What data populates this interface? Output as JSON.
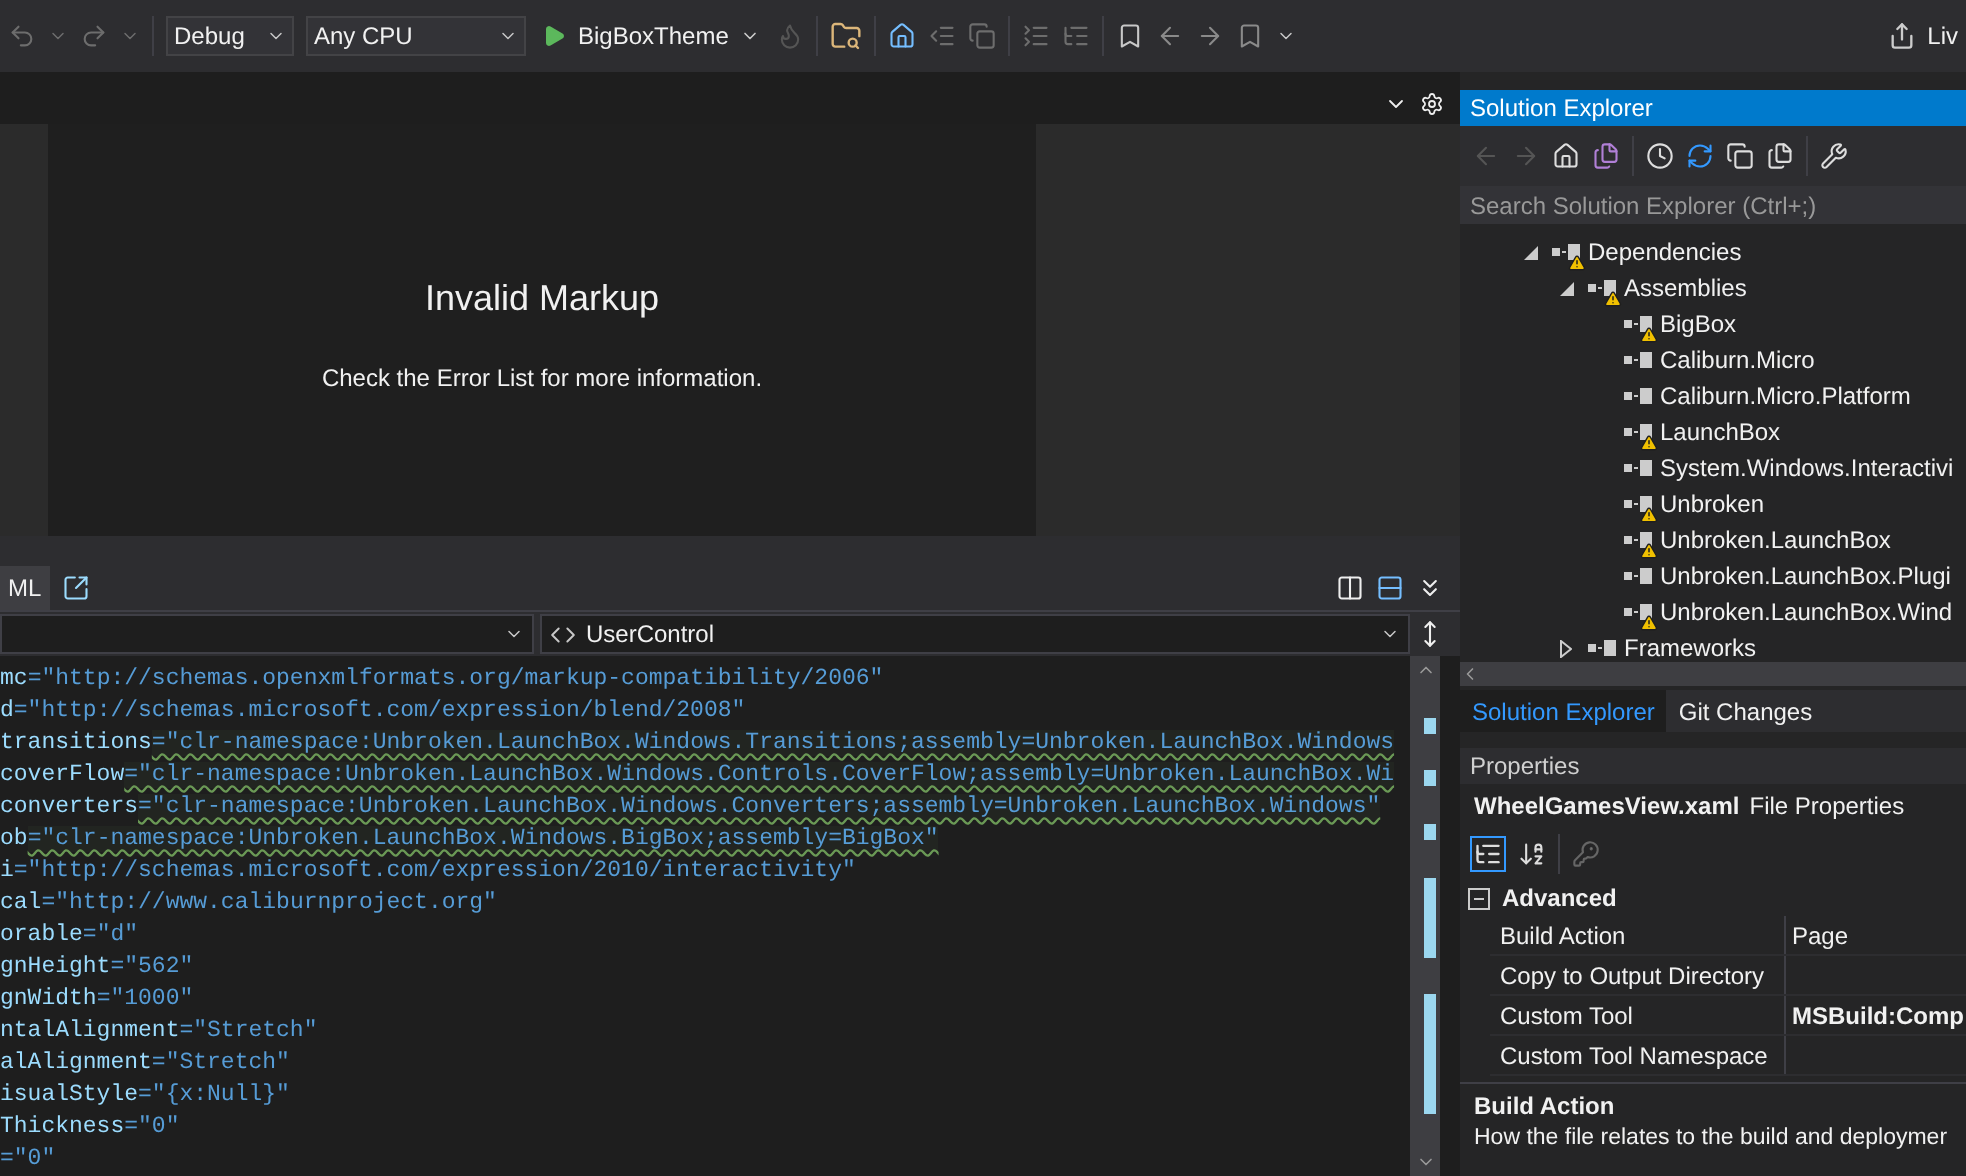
{
  "toolbar": {
    "configuration": "Debug",
    "platform": "Any CPU",
    "start_target": "BigBoxTheme",
    "live_share": "Liv"
  },
  "designer": {
    "title": "Invalid Markup",
    "message": "Check the Error List for more information."
  },
  "editor_tabs": [
    {
      "label": "ML",
      "selected": true
    }
  ],
  "navigation": {
    "scope": "UserControl"
  },
  "code_lines": [
    {
      "attr": "mc",
      "value": "=\"http://schemas.openxmlformats.org/markup-compatibility/2006\"",
      "squiggle": false
    },
    {
      "attr": "d",
      "value": "=\"http://schemas.microsoft.com/expression/blend/2008\"",
      "squiggle": false
    },
    {
      "attr": "transitions",
      "value": "=\"clr-namespace:Unbroken.LaunchBox.Windows.Transitions;assembly=Unbroken.LaunchBox.Windows",
      "squiggle": true
    },
    {
      "attr": "coverFlow",
      "value": "=\"clr-namespace:Unbroken.LaunchBox.Windows.Controls.CoverFlow;assembly=Unbroken.LaunchBox.Wi",
      "squiggle": true
    },
    {
      "attr": "converters",
      "value": "=\"clr-namespace:Unbroken.LaunchBox.Windows.Converters;assembly=Unbroken.LaunchBox.Windows\"",
      "squiggle": true
    },
    {
      "attr": "ob",
      "value": "=\"clr-namespace:Unbroken.LaunchBox.Windows.BigBox;assembly=BigBox\"",
      "squiggle": true
    },
    {
      "attr": "i",
      "value": "=\"http://schemas.microsoft.com/expression/2010/interactivity\"",
      "squiggle": false
    },
    {
      "attr": "cal",
      "value": "=\"http://www.caliburnproject.org\"",
      "squiggle": false
    },
    {
      "attr": "orable",
      "value": "=\"d\"",
      "squiggle": false
    },
    {
      "attr": "gnHeight",
      "value": "=\"562\"",
      "squiggle": false
    },
    {
      "attr": "gnWidth",
      "value": "=\"1000\"",
      "squiggle": false
    },
    {
      "attr": "ntalAlignment",
      "value": "=\"Stretch\"",
      "squiggle": false
    },
    {
      "attr": "alAlignment",
      "value": "=\"Stretch\"",
      "squiggle": false
    },
    {
      "attr": "isualStyle",
      "value": "=\"{x:Null}\"",
      "squiggle": false
    },
    {
      "attr": "Thickness",
      "value": "=\"0\"",
      "squiggle": false
    },
    {
      "value": "=\"0\"",
      "squiggle": false
    }
  ],
  "solution_explorer": {
    "title": "Solution Explorer",
    "search_placeholder": "Search Solution Explorer (Ctrl+;)",
    "tree": [
      {
        "label": "Dependencies",
        "expanded": true,
        "warning": true,
        "children": [
          {
            "label": "Assemblies",
            "expanded": true,
            "warning": true,
            "children": [
              {
                "label": "BigBox",
                "warning": true
              },
              {
                "label": "Caliburn.Micro",
                "warning": false
              },
              {
                "label": "Caliburn.Micro.Platform",
                "warning": false
              },
              {
                "label": "LaunchBox",
                "warning": true
              },
              {
                "label": "System.Windows.Interactivi",
                "warning": false
              },
              {
                "label": "Unbroken",
                "warning": true
              },
              {
                "label": "Unbroken.LaunchBox",
                "warning": true
              },
              {
                "label": "Unbroken.LaunchBox.Plugi",
                "warning": false
              },
              {
                "label": "Unbroken.LaunchBox.Wind",
                "warning": true
              }
            ]
          },
          {
            "label": "Frameworks",
            "expanded": false,
            "warning": false
          }
        ]
      }
    ]
  },
  "panel_tabs": [
    {
      "label": "Solution Explorer",
      "selected": true
    },
    {
      "label": "Git Changes",
      "selected": false
    }
  ],
  "properties": {
    "title": "Properties",
    "object": "WheelGamesView.xaml",
    "object_type": "File Properties",
    "categories": [
      {
        "name": "Advanced",
        "expanded": true,
        "rows": [
          {
            "name": "Build Action",
            "value": "Page",
            "bold": false
          },
          {
            "name": "Copy to Output Directory"
          },
          {
            "name": "Custom Tool",
            "value": "MSBuild:Comp",
            "bold": true
          },
          {
            "name": "Custom Tool Namespace"
          }
        ]
      }
    ],
    "description_title": "Build Action",
    "description": "How the file relates to the build and deploymer"
  }
}
